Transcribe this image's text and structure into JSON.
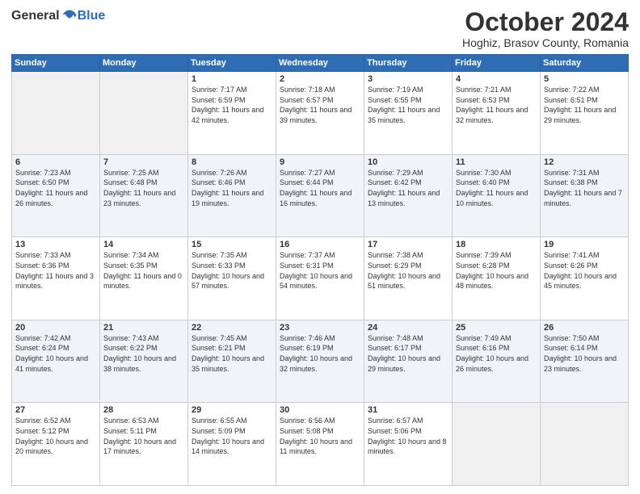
{
  "header": {
    "logo_general": "General",
    "logo_blue": "Blue",
    "month": "October 2024",
    "location": "Hoghiz, Brasov County, Romania"
  },
  "weekdays": [
    "Sunday",
    "Monday",
    "Tuesday",
    "Wednesday",
    "Thursday",
    "Friday",
    "Saturday"
  ],
  "weeks": [
    [
      {
        "day": "",
        "detail": ""
      },
      {
        "day": "",
        "detail": ""
      },
      {
        "day": "1",
        "detail": "Sunrise: 7:17 AM\nSunset: 6:59 PM\nDaylight: 11 hours and 42 minutes."
      },
      {
        "day": "2",
        "detail": "Sunrise: 7:18 AM\nSunset: 6:57 PM\nDaylight: 11 hours and 39 minutes."
      },
      {
        "day": "3",
        "detail": "Sunrise: 7:19 AM\nSunset: 6:55 PM\nDaylight: 11 hours and 35 minutes."
      },
      {
        "day": "4",
        "detail": "Sunrise: 7:21 AM\nSunset: 6:53 PM\nDaylight: 11 hours and 32 minutes."
      },
      {
        "day": "5",
        "detail": "Sunrise: 7:22 AM\nSunset: 6:51 PM\nDaylight: 11 hours and 29 minutes."
      }
    ],
    [
      {
        "day": "6",
        "detail": "Sunrise: 7:23 AM\nSunset: 6:50 PM\nDaylight: 11 hours and 26 minutes."
      },
      {
        "day": "7",
        "detail": "Sunrise: 7:25 AM\nSunset: 6:48 PM\nDaylight: 11 hours and 23 minutes."
      },
      {
        "day": "8",
        "detail": "Sunrise: 7:26 AM\nSunset: 6:46 PM\nDaylight: 11 hours and 19 minutes."
      },
      {
        "day": "9",
        "detail": "Sunrise: 7:27 AM\nSunset: 6:44 PM\nDaylight: 11 hours and 16 minutes."
      },
      {
        "day": "10",
        "detail": "Sunrise: 7:29 AM\nSunset: 6:42 PM\nDaylight: 11 hours and 13 minutes."
      },
      {
        "day": "11",
        "detail": "Sunrise: 7:30 AM\nSunset: 6:40 PM\nDaylight: 11 hours and 10 minutes."
      },
      {
        "day": "12",
        "detail": "Sunrise: 7:31 AM\nSunset: 6:38 PM\nDaylight: 11 hours and 7 minutes."
      }
    ],
    [
      {
        "day": "13",
        "detail": "Sunrise: 7:33 AM\nSunset: 6:36 PM\nDaylight: 11 hours and 3 minutes."
      },
      {
        "day": "14",
        "detail": "Sunrise: 7:34 AM\nSunset: 6:35 PM\nDaylight: 11 hours and 0 minutes."
      },
      {
        "day": "15",
        "detail": "Sunrise: 7:35 AM\nSunset: 6:33 PM\nDaylight: 10 hours and 57 minutes."
      },
      {
        "day": "16",
        "detail": "Sunrise: 7:37 AM\nSunset: 6:31 PM\nDaylight: 10 hours and 54 minutes."
      },
      {
        "day": "17",
        "detail": "Sunrise: 7:38 AM\nSunset: 6:29 PM\nDaylight: 10 hours and 51 minutes."
      },
      {
        "day": "18",
        "detail": "Sunrise: 7:39 AM\nSunset: 6:28 PM\nDaylight: 10 hours and 48 minutes."
      },
      {
        "day": "19",
        "detail": "Sunrise: 7:41 AM\nSunset: 6:26 PM\nDaylight: 10 hours and 45 minutes."
      }
    ],
    [
      {
        "day": "20",
        "detail": "Sunrise: 7:42 AM\nSunset: 6:24 PM\nDaylight: 10 hours and 41 minutes."
      },
      {
        "day": "21",
        "detail": "Sunrise: 7:43 AM\nSunset: 6:22 PM\nDaylight: 10 hours and 38 minutes."
      },
      {
        "day": "22",
        "detail": "Sunrise: 7:45 AM\nSunset: 6:21 PM\nDaylight: 10 hours and 35 minutes."
      },
      {
        "day": "23",
        "detail": "Sunrise: 7:46 AM\nSunset: 6:19 PM\nDaylight: 10 hours and 32 minutes."
      },
      {
        "day": "24",
        "detail": "Sunrise: 7:48 AM\nSunset: 6:17 PM\nDaylight: 10 hours and 29 minutes."
      },
      {
        "day": "25",
        "detail": "Sunrise: 7:49 AM\nSunset: 6:16 PM\nDaylight: 10 hours and 26 minutes."
      },
      {
        "day": "26",
        "detail": "Sunrise: 7:50 AM\nSunset: 6:14 PM\nDaylight: 10 hours and 23 minutes."
      }
    ],
    [
      {
        "day": "27",
        "detail": "Sunrise: 6:52 AM\nSunset: 5:12 PM\nDaylight: 10 hours and 20 minutes."
      },
      {
        "day": "28",
        "detail": "Sunrise: 6:53 AM\nSunset: 5:11 PM\nDaylight: 10 hours and 17 minutes."
      },
      {
        "day": "29",
        "detail": "Sunrise: 6:55 AM\nSunset: 5:09 PM\nDaylight: 10 hours and 14 minutes."
      },
      {
        "day": "30",
        "detail": "Sunrise: 6:56 AM\nSunset: 5:08 PM\nDaylight: 10 hours and 11 minutes."
      },
      {
        "day": "31",
        "detail": "Sunrise: 6:57 AM\nSunset: 5:06 PM\nDaylight: 10 hours and 8 minutes."
      },
      {
        "day": "",
        "detail": ""
      },
      {
        "day": "",
        "detail": ""
      }
    ]
  ]
}
